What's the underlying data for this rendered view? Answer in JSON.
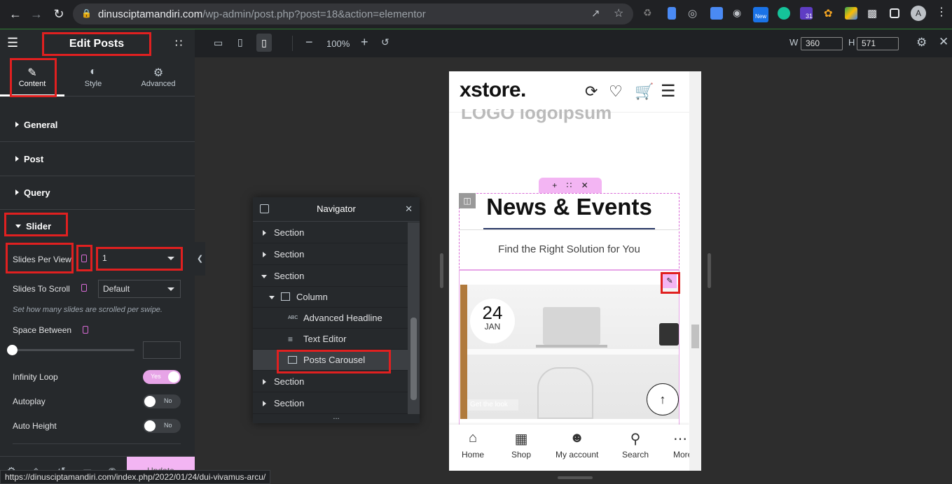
{
  "browser": {
    "url_domain": "dinusciptamandiri.com",
    "url_path": "/wp-admin/post.php?post=18&action=elementor",
    "ext_new_label": "New",
    "ext_calendar_label": "31",
    "profile_initial": "A"
  },
  "topbar": {
    "title": "Edit Posts Carousel",
    "zoom": "100%",
    "width_label": "W",
    "width_value": "360",
    "height_label": "H",
    "height_value": "571"
  },
  "panel": {
    "tabs": [
      {
        "label": "Content",
        "icon": "pencil-icon"
      },
      {
        "label": "Style",
        "icon": "contrast-icon"
      },
      {
        "label": "Advanced",
        "icon": "gear-icon"
      }
    ],
    "sections": [
      "General",
      "Post",
      "Query",
      "Slider"
    ],
    "controls": {
      "slides_per_view": {
        "label": "Slides Per View",
        "value": "1"
      },
      "slides_to_scroll": {
        "label": "Slides To Scroll",
        "value": "Default",
        "note": "Set how many slides are scrolled per swipe."
      },
      "space_between": {
        "label": "Space Between",
        "value": ""
      },
      "infinity_loop": {
        "label": "Infinity Loop",
        "state": "Yes"
      },
      "autoplay": {
        "label": "Autoplay",
        "state": "No"
      },
      "auto_height": {
        "label": "Auto Height",
        "state": "No"
      }
    },
    "update_label": "Update"
  },
  "navigator": {
    "title": "Navigator",
    "items": [
      {
        "label": "Section"
      },
      {
        "label": "Section"
      },
      {
        "label": "Section"
      },
      {
        "label": "Column"
      },
      {
        "label": "Advanced Headline"
      },
      {
        "label": "Text Editor"
      },
      {
        "label": "Posts Carousel"
      },
      {
        "label": "Section"
      },
      {
        "label": "Section"
      }
    ],
    "more": "..."
  },
  "preview": {
    "brand": "xstore.",
    "logos_text": "LOGO  logoipsum",
    "heading": "News & Events",
    "subtitle": "Find the Right Solution for You",
    "date_day": "24",
    "date_month": "JAN",
    "get_look": "Get the look",
    "bottom_nav": [
      {
        "label": "Home",
        "icon": "home-icon"
      },
      {
        "label": "Shop",
        "icon": "shop-icon"
      },
      {
        "label": "My account",
        "icon": "user-icon"
      },
      {
        "label": "Search",
        "icon": "search-icon"
      },
      {
        "label": "More",
        "icon": "more-icon"
      }
    ]
  },
  "status_url": "https://dinusciptamandiri.com/index.php/2022/01/24/dui-vivamus-arcu/",
  "colors": {
    "accent_pink": "#f3b5f3",
    "highlight_red": "#e02020",
    "panel_bg": "#26292c"
  }
}
